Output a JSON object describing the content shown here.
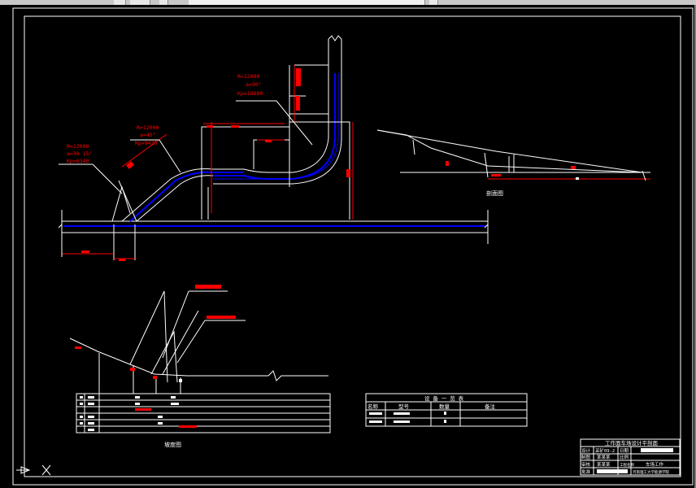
{
  "drawing": {
    "curve1": {
      "r": "R=12000",
      "a": "a=90°",
      "kp": "Kp=18880"
    },
    "curve2": {
      "r": "R=12000",
      "a": "a=45°",
      "kp": "Kp=9425"
    },
    "curve3": {
      "r": "R=12000",
      "a": "a=30 15°",
      "kp": "Kp=6340"
    }
  },
  "section_view": {
    "label": "剖面图"
  },
  "slope_view": {
    "label": "坡度图"
  },
  "equipment_table": {
    "title": "设 备 一 览 表",
    "headers": [
      "名称",
      "型号",
      "数量",
      "备注"
    ]
  },
  "title_block": {
    "title": "工作面车场设计平剖面",
    "rows": [
      [
        "设计",
        "采矿09-2",
        "日期",
        ""
      ],
      [
        "制图",
        "某某某",
        "比例",
        ""
      ],
      [
        "审核",
        "某某某",
        "工程名称",
        "车场工作"
      ],
      [
        "批准",
        "",
        "河南理工大学",
        "河南理工大学能源学院"
      ]
    ]
  },
  "colors": {
    "background": "#000000",
    "line": "#ffffff",
    "accent": "#ff0000",
    "track": "#0000ff"
  }
}
